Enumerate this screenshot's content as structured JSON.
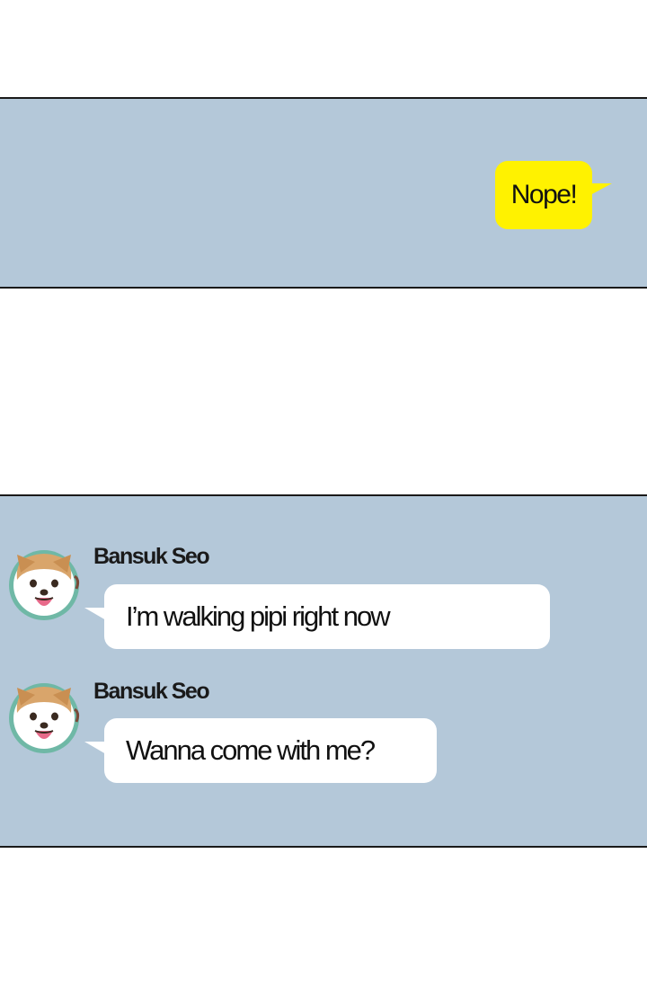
{
  "outgoing": {
    "text": "Nope!",
    "bubble_color": "#fff200"
  },
  "incoming": [
    {
      "sender": "Bansuk Seo",
      "text": "I’m walking pipi right now",
      "avatar_icon": "corgi-avatar-icon"
    },
    {
      "sender": "Bansuk Seo",
      "text": "Wanna come with me?",
      "avatar_icon": "corgi-avatar-icon"
    }
  ],
  "colors": {
    "chat_background": "#b4c8d9",
    "incoming_bubble": "#ffffff",
    "avatar_ring": "#6fb8a6"
  }
}
